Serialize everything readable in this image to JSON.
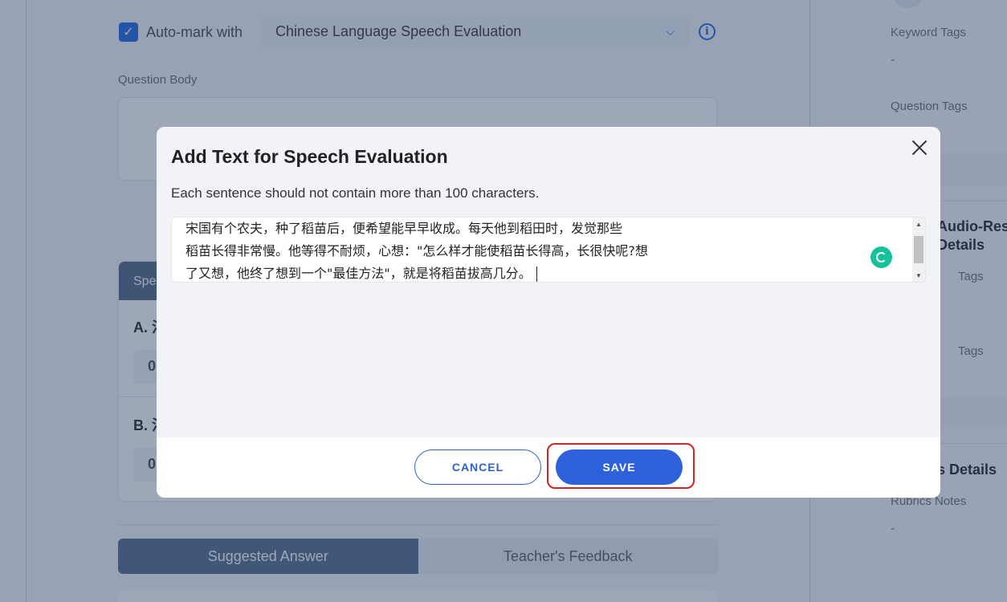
{
  "background": {
    "auto_mark": {
      "checked": true,
      "check_mark": "✓",
      "label": "Auto-mark with",
      "selected_option": "Chinese Language Speech Evaluation",
      "chevron": "chevron-down-icon",
      "info_glyph": "i"
    },
    "question_body_label": "Question Body",
    "spec_card": {
      "header_label": "Spee",
      "option_a": "A. 汴",
      "option_a_value": "0",
      "option_b": "B. 汴",
      "option_b_value": "0"
    },
    "tabs": [
      {
        "label": "Suggested Answer",
        "active": true
      },
      {
        "label": "Teacher's Feedback",
        "active": false
      }
    ],
    "right_panel": {
      "keyword_tags_label": "Keyword Tags",
      "keyword_tags_value": "-",
      "question_tags_label": "Question Tags",
      "audio_heading_line1": "Audio-Resp",
      "audio_heading_line2": "Details",
      "tags_label_1": "Tags",
      "tags_label_2": "Tags",
      "rubrics_heading": "s Details",
      "rubrics_notes_label": "Rubrics Notes",
      "rubrics_notes_value": "-"
    }
  },
  "modal": {
    "title": "Add Text for Speech Evaluation",
    "subtitle": "Each sentence should not contain more than 100 characters.",
    "text_value": "宋国有个农夫，种了稻苗后，便希望能早早收成。每天他到稻田时，发觉那些\n稻苗长得非常慢。他等得不耐烦，心想：\"怎么样才能使稻苗长得高，长很快呢?想\n了又想，他终了想到一个\"最佳方法\"，就是将稻苗拔高几分。",
    "cancel_label": "CANCEL",
    "save_label": "SAVE",
    "close_icon": "close-icon",
    "grammar_icon": "grammar-check-icon"
  },
  "colors": {
    "accent": "#2f62da",
    "highlight": "#d42424",
    "grammar": "#15c39a"
  }
}
